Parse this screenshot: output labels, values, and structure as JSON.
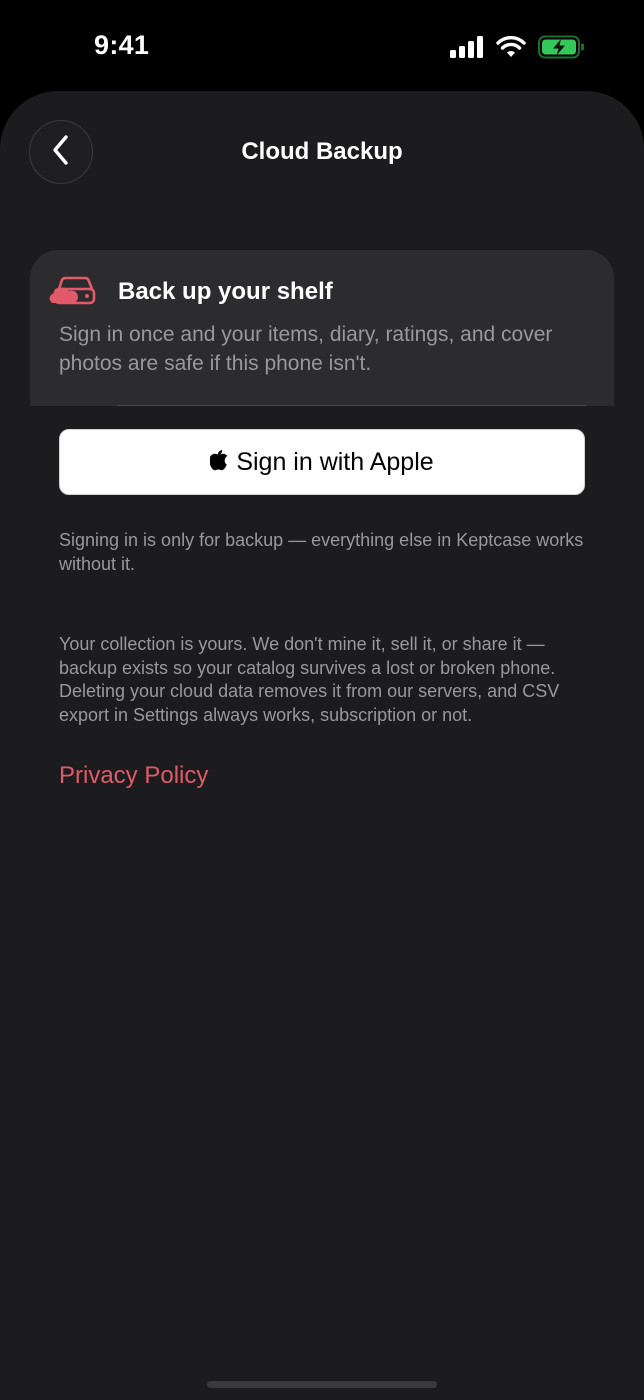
{
  "status_bar": {
    "time": "9:41",
    "icons": [
      "signal-icon",
      "wifi-icon",
      "battery-charging-icon"
    ],
    "battery_color": "#34c759"
  },
  "nav": {
    "back_icon": "chevron-left-icon",
    "title": "Cloud Backup"
  },
  "card": {
    "icon": "cloud-drive-icon",
    "title": "Back up your shelf",
    "body": "Sign in once and your items, diary, ratings, and cover photos are safe if this phone isn't."
  },
  "apple_button": {
    "icon": "apple-logo-icon",
    "label": "Sign in with Apple"
  },
  "notes": {
    "signin": "Signing in is only for backup — everything else in Keptcase works without it.",
    "privacy": "Your collection is yours. We don't mine it, sell it, or share it — backup exists so your catalog survives a lost or broken phone. Deleting your cloud data removes it from our servers, and CSV export in Settings always works, subscription or not."
  },
  "privacy_link": "Privacy Policy",
  "colors": {
    "accent": "#e05a6a",
    "background": "#1c1c1e",
    "card": "#2c2c2e",
    "secondary_text": "#98989d"
  }
}
